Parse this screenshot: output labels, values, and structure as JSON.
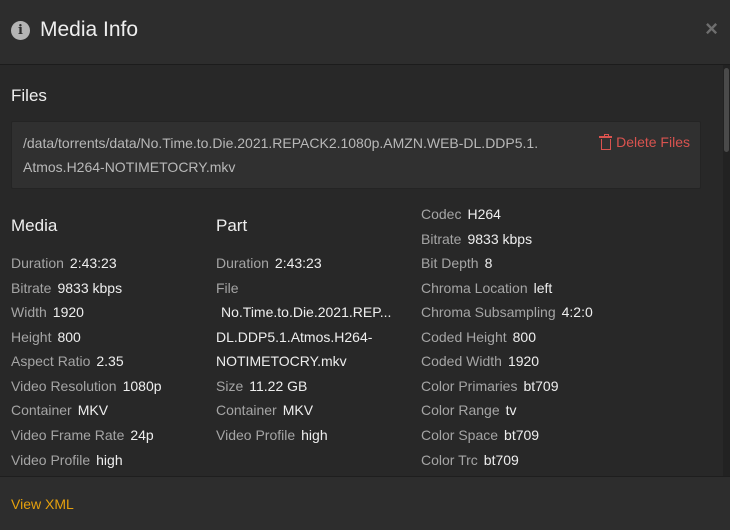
{
  "header": {
    "title": "Media Info",
    "info_icon_glyph": "i",
    "close_glyph": "×"
  },
  "files": {
    "heading": "Files",
    "path": "/data/torrents/data/No.Time.to.Die.2021.REPACK2.1080p.AMZN.WEB-DL.DDP5.1.Atmos.H264-NOTIMETOCRY.mkv",
    "delete_label": "Delete Files",
    "delete_color": "#d9534f"
  },
  "media": {
    "heading": "Media",
    "rows": [
      {
        "label": "Duration",
        "value": "2:43:23"
      },
      {
        "label": "Bitrate",
        "value": "9833 kbps"
      },
      {
        "label": "Width",
        "value": "1920"
      },
      {
        "label": "Height",
        "value": "800"
      },
      {
        "label": "Aspect Ratio",
        "value": "2.35"
      },
      {
        "label": "Video Resolution",
        "value": "1080p"
      },
      {
        "label": "Container",
        "value": "MKV"
      },
      {
        "label": "Video Frame Rate",
        "value": "24p"
      },
      {
        "label": "Video Profile",
        "value": "high"
      }
    ]
  },
  "part": {
    "heading": "Part",
    "duration_label": "Duration",
    "duration_value": "2:43:23",
    "file_label": "File",
    "file_value_line1": "No.Time.to.Die.2021.REP...",
    "file_value_line2": "DL.DDP5.1.Atmos.H264-",
    "file_value_line3": "NOTIMETOCRY.mkv",
    "size_label": "Size",
    "size_value": "11.22 GB",
    "container_label": "Container",
    "container_value": "MKV",
    "profile_label": "Video Profile",
    "profile_value": "high"
  },
  "stream": {
    "rows": [
      {
        "label": "Codec",
        "value": "H264"
      },
      {
        "label": "Bitrate",
        "value": "9833 kbps"
      },
      {
        "label": "Bit Depth",
        "value": "8"
      },
      {
        "label": "Chroma Location",
        "value": "left"
      },
      {
        "label": "Chroma Subsampling",
        "value": "4:2:0"
      },
      {
        "label": "Coded Height",
        "value": "800"
      },
      {
        "label": "Coded Width",
        "value": "1920"
      },
      {
        "label": "Color Primaries",
        "value": "bt709"
      },
      {
        "label": "Color Range",
        "value": "tv"
      },
      {
        "label": "Color Space",
        "value": "bt709"
      },
      {
        "label": "Color Trc",
        "value": "bt709"
      }
    ]
  },
  "footer": {
    "view_xml_label": "View XML",
    "accent_color": "#e5a00d"
  }
}
